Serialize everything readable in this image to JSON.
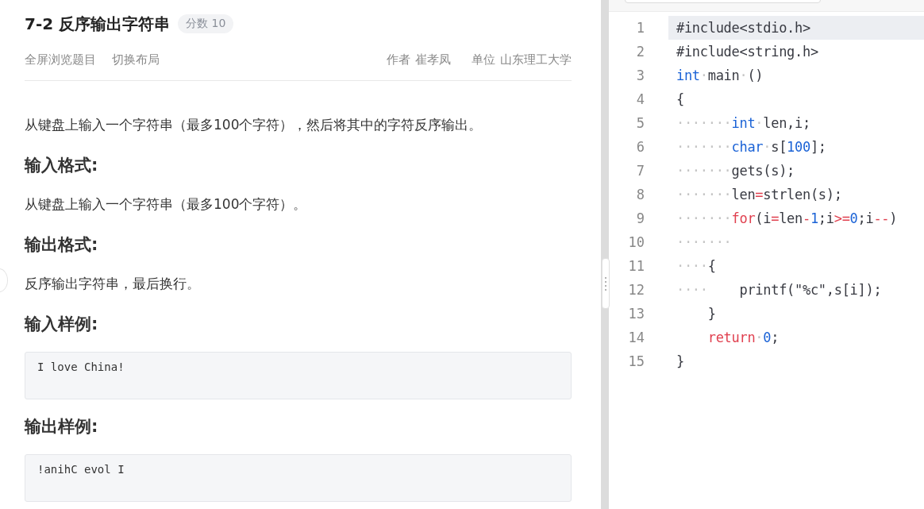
{
  "problem": {
    "title": "7-2 反序输出字符串",
    "score": "分数 10",
    "actions": [
      "全屏浏览题目",
      "切换布局"
    ],
    "author_label": "作者",
    "author": "崔孝凤",
    "unit_label": "单位",
    "unit": "山东理工大学"
  },
  "body": [
    {
      "kind": "paragraph",
      "text": "从键盘上输入一个字符串（最多100个字符），然后将其中的字符反序输出。"
    },
    {
      "kind": "heading",
      "text": "输入格式:"
    },
    {
      "kind": "paragraph",
      "text": "从键盘上输入一个字符串（最多100个字符）。"
    },
    {
      "kind": "heading",
      "text": "输出格式:"
    },
    {
      "kind": "paragraph",
      "text": "反序输出字符串，最后换行。"
    },
    {
      "kind": "heading",
      "text": "输入样例:"
    },
    {
      "kind": "sample",
      "text": "I love China!"
    },
    {
      "kind": "heading",
      "text": "输出样例:"
    },
    {
      "kind": "sample",
      "text": "!anihC evol I"
    }
  ],
  "editor": {
    "lines": [
      {
        "number": "1",
        "current": true,
        "tokens": [
          {
            "kind": "plain",
            "text": "#include<stdio.h>"
          }
        ]
      },
      {
        "number": "2",
        "current": false,
        "tokens": [
          {
            "kind": "plain",
            "text": "#include<string.h>"
          }
        ]
      },
      {
        "number": "3",
        "current": false,
        "tokens": [
          {
            "kind": "keyword",
            "text": "int"
          },
          {
            "kind": "ws",
            "text": "·"
          },
          {
            "kind": "plain",
            "text": "main"
          },
          {
            "kind": "ws",
            "text": "·"
          },
          {
            "kind": "plain",
            "text": "()"
          }
        ]
      },
      {
        "number": "4",
        "current": false,
        "tokens": [
          {
            "kind": "plain",
            "text": "{"
          }
        ]
      },
      {
        "number": "5",
        "current": false,
        "tokens": [
          {
            "kind": "ws",
            "text": "·······"
          },
          {
            "kind": "keyword",
            "text": "int"
          },
          {
            "kind": "ws",
            "text": "·"
          },
          {
            "kind": "plain",
            "text": "len,i;"
          }
        ]
      },
      {
        "number": "6",
        "current": false,
        "tokens": [
          {
            "kind": "ws",
            "text": "·······"
          },
          {
            "kind": "keyword",
            "text": "char"
          },
          {
            "kind": "ws",
            "text": "·"
          },
          {
            "kind": "plain",
            "text": "s["
          },
          {
            "kind": "number",
            "text": "100"
          },
          {
            "kind": "plain",
            "text": "];"
          }
        ]
      },
      {
        "number": "7",
        "current": false,
        "tokens": [
          {
            "kind": "ws",
            "text": "·······"
          },
          {
            "kind": "plain",
            "text": "gets(s);"
          }
        ]
      },
      {
        "number": "8",
        "current": false,
        "tokens": [
          {
            "kind": "ws",
            "text": "·······"
          },
          {
            "kind": "plain",
            "text": "len"
          },
          {
            "kind": "operator",
            "text": "="
          },
          {
            "kind": "plain",
            "text": "strlen(s);"
          }
        ]
      },
      {
        "number": "9",
        "current": false,
        "tokens": [
          {
            "kind": "ws",
            "text": "·······"
          },
          {
            "kind": "control",
            "text": "for"
          },
          {
            "kind": "plain",
            "text": "(i"
          },
          {
            "kind": "operator",
            "text": "="
          },
          {
            "kind": "plain",
            "text": "len"
          },
          {
            "kind": "operator",
            "text": "-"
          },
          {
            "kind": "number",
            "text": "1"
          },
          {
            "kind": "plain",
            "text": ";i"
          },
          {
            "kind": "operator",
            "text": ">="
          },
          {
            "kind": "number",
            "text": "0"
          },
          {
            "kind": "plain",
            "text": ";i"
          },
          {
            "kind": "operator",
            "text": "--"
          },
          {
            "kind": "plain",
            "text": ")"
          }
        ]
      },
      {
        "number": "10",
        "current": false,
        "tokens": [
          {
            "kind": "ws",
            "text": "·······"
          }
        ]
      },
      {
        "number": "11",
        "current": false,
        "tokens": [
          {
            "kind": "ws",
            "text": "····"
          },
          {
            "kind": "plain",
            "text": "{"
          }
        ]
      },
      {
        "number": "12",
        "current": false,
        "tokens": [
          {
            "kind": "ws",
            "text": "····"
          },
          {
            "kind": "plain",
            "text": "    printf(\"%c\",s[i]);"
          }
        ]
      },
      {
        "number": "13",
        "current": false,
        "tokens": [
          {
            "kind": "plain",
            "text": "    }"
          }
        ]
      },
      {
        "number": "14",
        "current": false,
        "tokens": [
          {
            "kind": "control",
            "text": "    return"
          },
          {
            "kind": "ws",
            "text": "·"
          },
          {
            "kind": "number",
            "text": "0"
          },
          {
            "kind": "plain",
            "text": ";"
          }
        ]
      },
      {
        "number": "15",
        "current": false,
        "tokens": [
          {
            "kind": "plain",
            "text": "}"
          }
        ]
      }
    ]
  }
}
